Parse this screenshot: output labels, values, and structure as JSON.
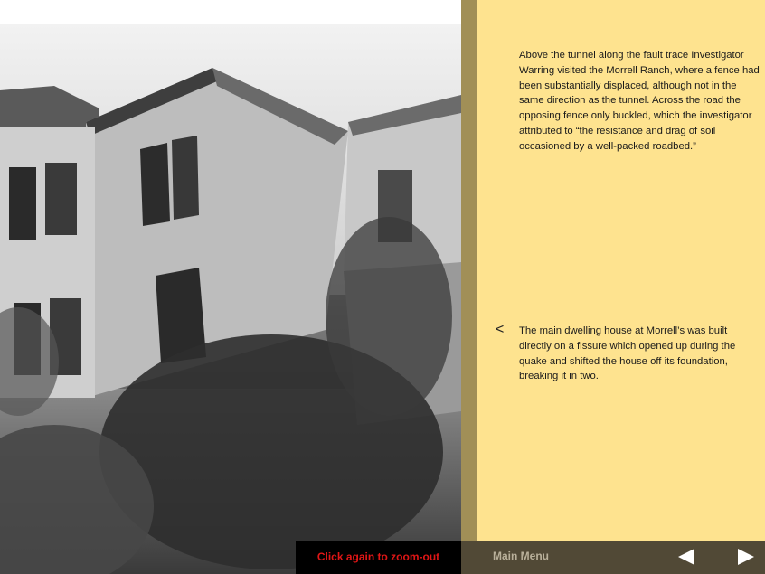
{
  "photo": {
    "subject": "house-photograph"
  },
  "text": {
    "paragraph_1": "Above the tunnel along the fault trace Investigator Warring visited the Morrell Ranch, where a fence had been substantially displaced, although not in the same direction as the tunnel. Across the road the opposing fence only buckled, which the investigator attributed to “the resistance and drag of soil occasioned by a well-packed roadbed.”",
    "caret": "<",
    "paragraph_2": "The main dwelling house at Morrell’s was built directly on a fissure which opened up during the quake and shifted the house off its foundation, breaking it in two."
  },
  "bottom": {
    "main_menu": "Main Menu",
    "zoom_label": "Click again to zoom-out",
    "prev_icon": "triangle-left-icon",
    "next_icon": "triangle-right-icon"
  },
  "colors": {
    "panel": "#fee38f",
    "divider": "#a18f57",
    "bottom_bar": "#514936",
    "zoom_text": "#e01616"
  }
}
